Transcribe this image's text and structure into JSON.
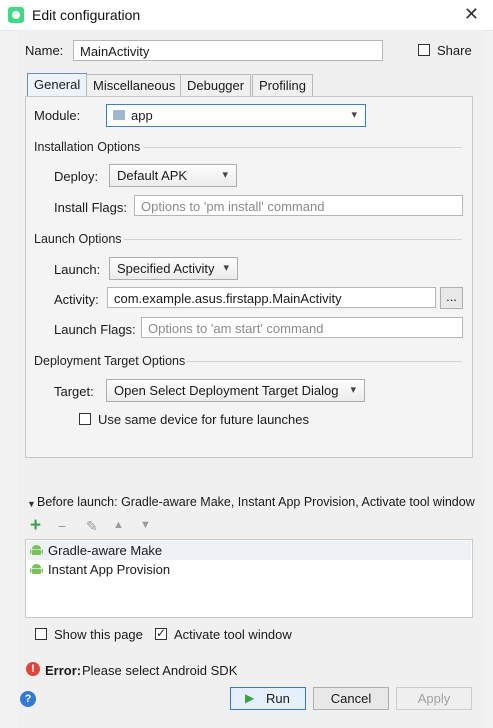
{
  "window": {
    "title": "Edit configuration",
    "close_glyph": "✕"
  },
  "name_row": {
    "label": "Name:",
    "value": "MainActivity",
    "share_label": "Share",
    "share_checked": false
  },
  "tabs": [
    {
      "label": "General",
      "active": true
    },
    {
      "label": "Miscellaneous",
      "active": false
    },
    {
      "label": "Debugger",
      "active": false
    },
    {
      "label": "Profiling",
      "active": false
    }
  ],
  "general": {
    "module_label": "Module:",
    "module_value": "app",
    "installation": {
      "title": "Installation Options",
      "deploy_label": "Deploy:",
      "deploy_value": "Default APK",
      "flags_label": "Install Flags:",
      "flags_placeholder": "Options to 'pm install' command"
    },
    "launch": {
      "title": "Launch Options",
      "launch_label": "Launch:",
      "launch_value": "Specified Activity",
      "activity_label": "Activity:",
      "activity_value": "com.example.asus.firstapp.MainActivity",
      "browse_label": "...",
      "flags_label": "Launch Flags:",
      "flags_placeholder": "Options to 'am start' command"
    },
    "deployment_target": {
      "title": "Deployment Target Options",
      "target_label": "Target:",
      "target_value": "Open Select Deployment Target Dialog",
      "same_device_label": "Use same device for future launches",
      "same_device_checked": false
    }
  },
  "before_launch": {
    "header": "Before launch: Gradle-aware Make, Instant App Provision, Activate tool window",
    "toolbar": {
      "add": "+",
      "remove": "−",
      "edit": "✎",
      "up": "▲",
      "down": "▼"
    },
    "items": [
      "Gradle-aware Make",
      "Instant App Provision"
    ],
    "show_page_label": "Show this page",
    "show_page_checked": false,
    "activate_label": "Activate tool window",
    "activate_checked": true
  },
  "error": {
    "prefix": "Error:",
    "message": "Please select Android SDK"
  },
  "buttons": {
    "help": "?",
    "run": "Run",
    "cancel": "Cancel",
    "apply": "Apply"
  },
  "colors": {
    "accent": "#2f7bd6",
    "error": "#e0443a",
    "android_green": "#78c257",
    "run_green": "#3aa04a"
  }
}
